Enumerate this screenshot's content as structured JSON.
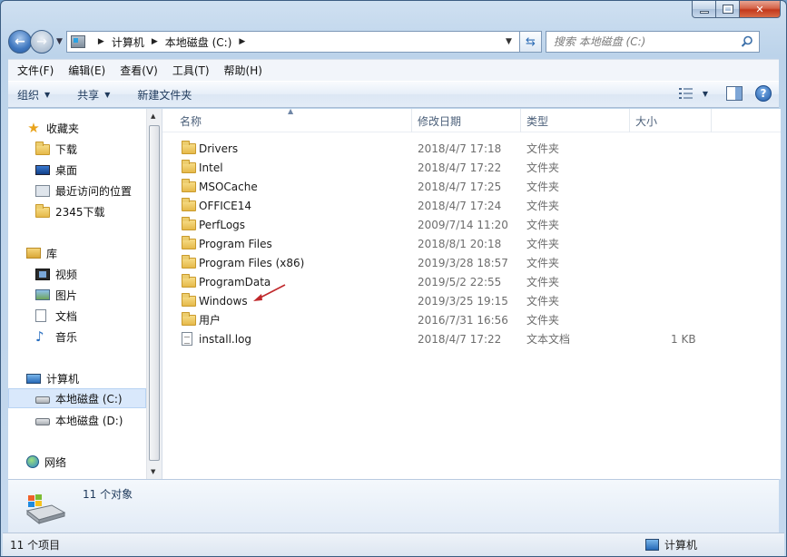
{
  "window": {
    "caption": {
      "minimize": "—",
      "maximize": "□",
      "close": "✕"
    }
  },
  "address": {
    "crumbs": [
      "计算机",
      "本地磁盘 (C:)"
    ],
    "search_placeholder": "搜索 本地磁盘 (C:)"
  },
  "menu": [
    "文件(F)",
    "编辑(E)",
    "查看(V)",
    "工具(T)",
    "帮助(H)"
  ],
  "commands": {
    "organize": "组织",
    "share": "共享",
    "new_folder": "新建文件夹",
    "help": "?"
  },
  "nav": {
    "favorites": "收藏夹",
    "downloads": "下载",
    "desktop": "桌面",
    "recent": "最近访问的位置",
    "dl2345": "2345下载",
    "libraries": "库",
    "videos": "视频",
    "pictures": "图片",
    "documents": "文档",
    "music": "音乐",
    "computer": "计算机",
    "drive_c": "本地磁盘 (C:)",
    "drive_d": "本地磁盘 (D:)",
    "network": "网络"
  },
  "columns": {
    "name": "名称",
    "date": "修改日期",
    "type": "类型",
    "size": "大小"
  },
  "files": [
    {
      "name": "Drivers",
      "date": "2018/4/7 17:18",
      "type": "文件夹",
      "size": "",
      "icon": "folder-icon"
    },
    {
      "name": "Intel",
      "date": "2018/4/7 17:22",
      "type": "文件夹",
      "size": "",
      "icon": "folder-icon"
    },
    {
      "name": "MSOCache",
      "date": "2018/4/7 17:25",
      "type": "文件夹",
      "size": "",
      "icon": "folder-icon"
    },
    {
      "name": "OFFICE14",
      "date": "2018/4/7 17:24",
      "type": "文件夹",
      "size": "",
      "icon": "folder-icon"
    },
    {
      "name": "PerfLogs",
      "date": "2009/7/14 11:20",
      "type": "文件夹",
      "size": "",
      "icon": "folder-icon"
    },
    {
      "name": "Program Files",
      "date": "2018/8/1 20:18",
      "type": "文件夹",
      "size": "",
      "icon": "folder-icon"
    },
    {
      "name": "Program Files (x86)",
      "date": "2019/3/28 18:57",
      "type": "文件夹",
      "size": "",
      "icon": "folder-icon"
    },
    {
      "name": "ProgramData",
      "date": "2019/5/2 22:55",
      "type": "文件夹",
      "size": "",
      "icon": "folder-icon"
    },
    {
      "name": "Windows",
      "date": "2019/3/25 19:15",
      "type": "文件夹",
      "size": "",
      "icon": "folder-icon"
    },
    {
      "name": "用户",
      "date": "2016/7/31 16:56",
      "type": "文件夹",
      "size": "",
      "icon": "folder-icon"
    },
    {
      "name": "install.log",
      "date": "2018/4/7 17:22",
      "type": "文本文档",
      "size": "1 KB",
      "icon": "text-file-icon"
    }
  ],
  "details": {
    "count": "11 个对象"
  },
  "status": {
    "items": "11 个项目",
    "location": "计算机"
  },
  "colors": {
    "annotation_arrow": "#c0282b",
    "selection": "#d9e8fb"
  }
}
